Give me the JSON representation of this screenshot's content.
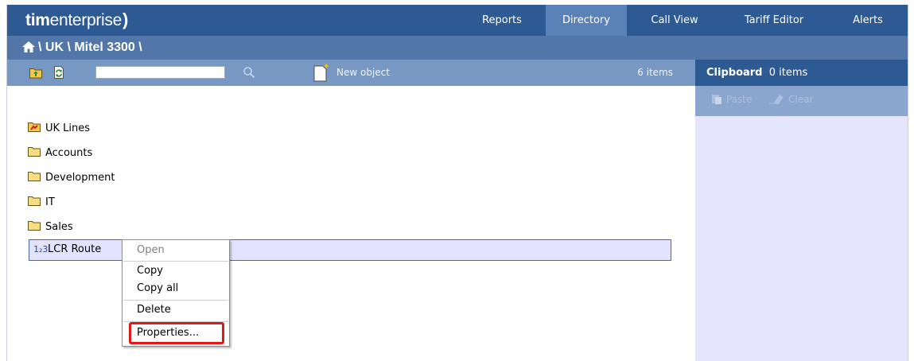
{
  "app": {
    "logo_bold": "tim",
    "logo_rest": "enterprise"
  },
  "nav": {
    "items": [
      {
        "label": "Reports",
        "active": false
      },
      {
        "label": "Directory",
        "active": true
      },
      {
        "label": "Call View",
        "active": false
      },
      {
        "label": "Tariff Editor",
        "active": false
      },
      {
        "label": "Alerts",
        "active": false
      }
    ]
  },
  "breadcrumb": {
    "path": "\\ UK \\ Mitel 3300 \\"
  },
  "toolbar": {
    "search_value": "",
    "new_object_label": "New object",
    "item_count": "6 items"
  },
  "list": {
    "items": [
      {
        "label": "UK Lines",
        "icon": "line-folder-icon"
      },
      {
        "label": "Accounts",
        "icon": "folder-icon"
      },
      {
        "label": "Development",
        "icon": "folder-icon"
      },
      {
        "label": "IT",
        "icon": "folder-icon"
      },
      {
        "label": "Sales",
        "icon": "folder-icon"
      }
    ],
    "selected": {
      "label": "LCR Route",
      "icon": "lcr-route-icon",
      "icon_text": "1₂3"
    }
  },
  "context_menu": {
    "open": "Open",
    "copy": "Copy",
    "copy_all": "Copy all",
    "delete": "Delete",
    "properties": "Properties..."
  },
  "clipboard": {
    "title": "Clipboard",
    "count": "0 items",
    "paste_label": "Paste",
    "clear_label": "Clear"
  },
  "colors": {
    "nav_bg": "#2d5a93",
    "nav_active": "#5b82b8",
    "breadcrumb_bg": "#5276a8",
    "toolbar_bg": "#7898c4",
    "clipboard_body": "#e5e5ff",
    "highlight": "#e01818"
  }
}
